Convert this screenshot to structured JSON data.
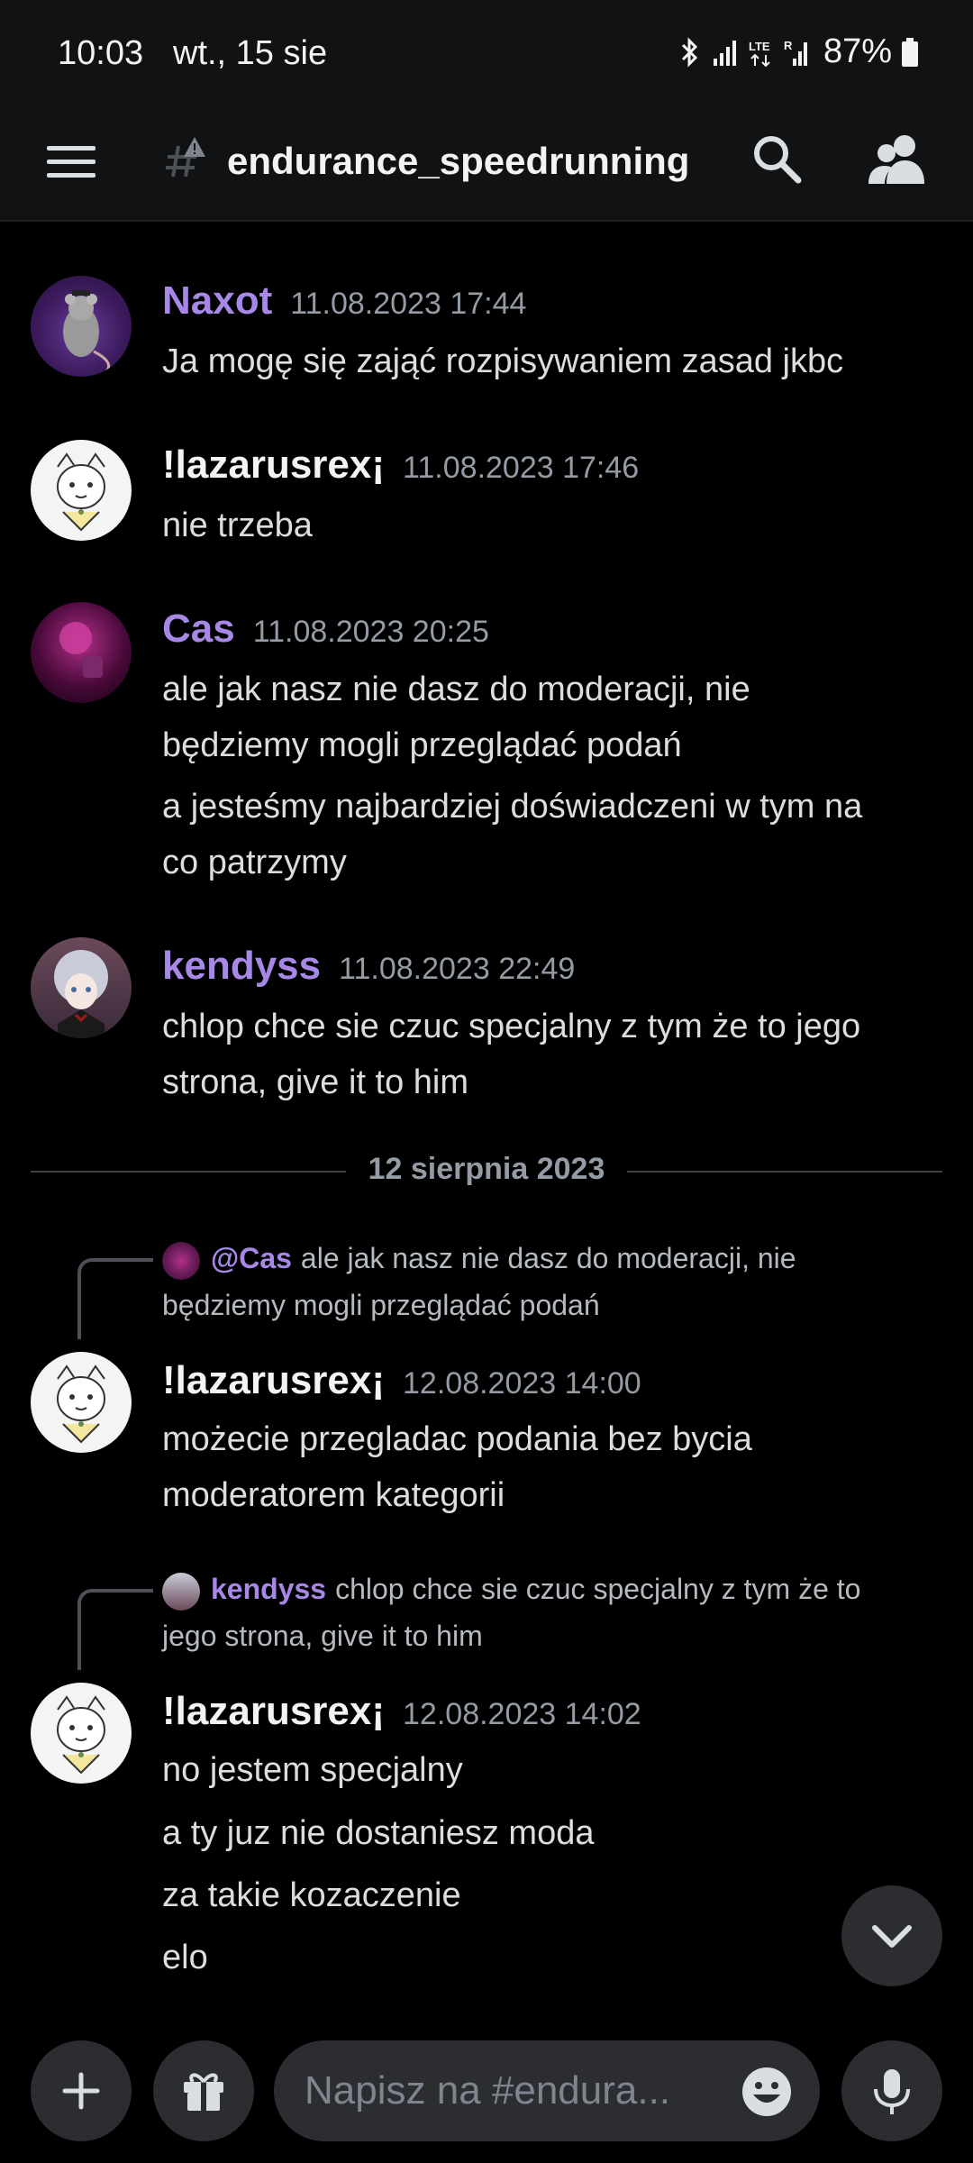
{
  "status_bar": {
    "time": "10:03",
    "date": "wt., 15 sie",
    "battery": "87%"
  },
  "header": {
    "channel_name": "endurance_speedrunning"
  },
  "messages": [
    {
      "author": "Naxot",
      "timestamp": "11.08.2023 17:44",
      "lines": [
        "Ja mogę się zająć rozpisywaniem zasad jkbc"
      ]
    },
    {
      "author": "!lazarusrex¡",
      "timestamp": "11.08.2023 17:46",
      "lines": [
        "nie trzeba"
      ]
    },
    {
      "author": "Cas",
      "timestamp": "11.08.2023 20:25",
      "lines": [
        "ale jak nasz nie dasz do moderacji, nie",
        "będziemy mogli przeglądać podań",
        "a jesteśmy najbardziej doświadczeni w tym na",
        "co patrzymy"
      ]
    },
    {
      "author": "kendyss",
      "timestamp": "11.08.2023 22:49",
      "lines": [
        "chlop chce sie czuc specjalny z tym że to jego",
        "strona, give it to him"
      ]
    },
    {
      "author": "!lazarusrex¡",
      "timestamp": "12.08.2023 14:00",
      "reply": {
        "author": "@Cas",
        "text_line1": "ale jak nasz nie dasz do moderacji, nie",
        "text_line2": "będziemy mogli przeglądać podań"
      },
      "lines": [
        "możecie przegladac podania bez bycia",
        "moderatorem kategorii"
      ]
    },
    {
      "author": "!lazarusrex¡",
      "timestamp": "12.08.2023 14:02",
      "reply": {
        "author": "kendyss",
        "text_line1": "chlop chce sie czuc specjalny z tym że to",
        "text_line2": "jego strona, give it to him"
      },
      "lines": [
        "no jestem specjalny",
        "a ty juz nie dostaniesz moda",
        "za takie kozaczenie",
        "elo"
      ]
    }
  ],
  "date_divider": "12 sierpnia 2023",
  "composer": {
    "placeholder": "Napisz na #endura..."
  },
  "colors": {
    "role_purple": "#a888e6",
    "background": "#000000",
    "surface": "#2b2d31"
  },
  "icons": {
    "menu": "hamburger-icon",
    "channel": "text-channel-locked-icon",
    "search": "search-icon",
    "members": "members-icon",
    "scroll": "chevron-down-icon",
    "add": "plus-icon",
    "gift": "gift-icon",
    "emoji": "emoji-icon",
    "mic": "microphone-icon"
  }
}
